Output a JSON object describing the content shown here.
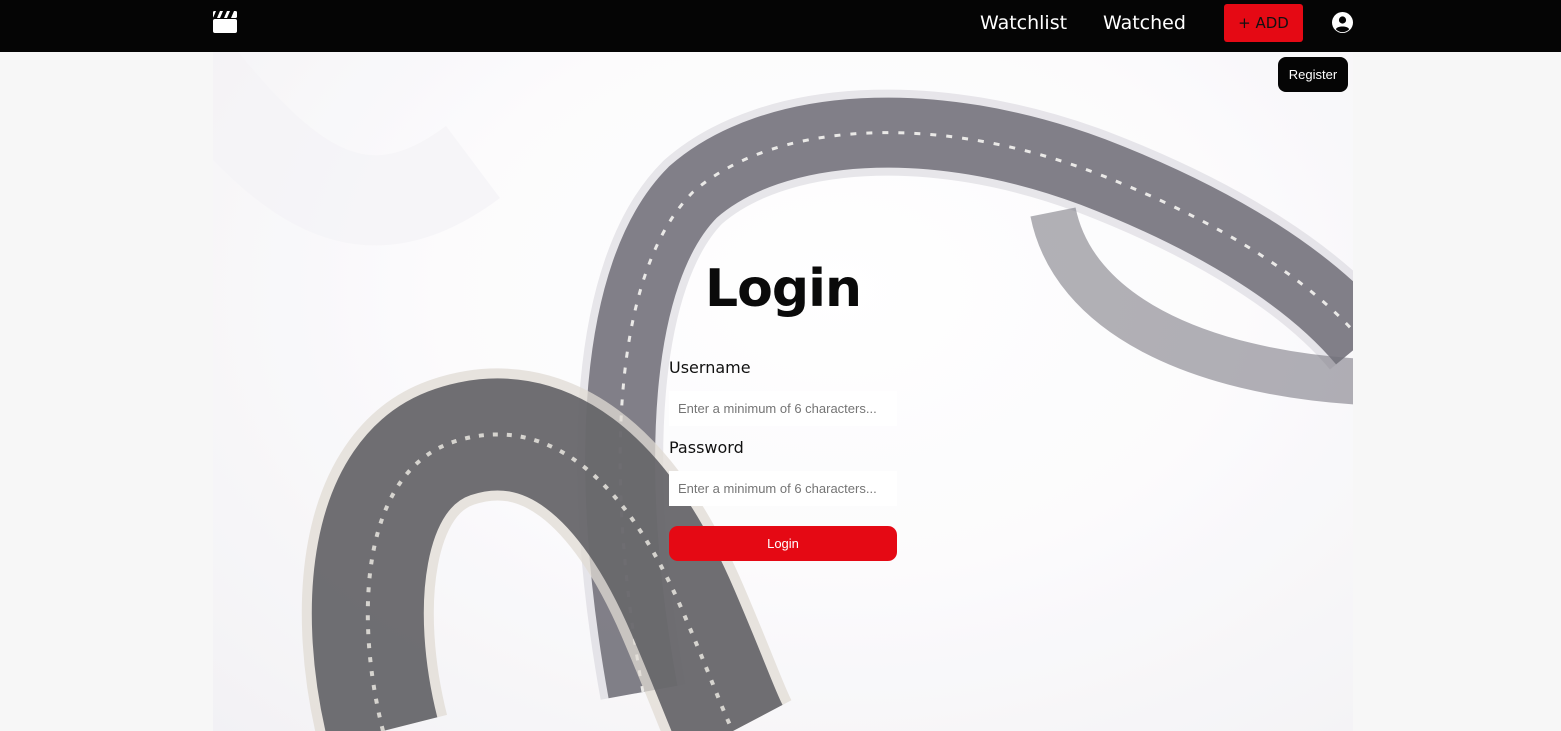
{
  "navbar": {
    "logo_icon": "clapperboard-icon",
    "links": [
      {
        "label": "Watchlist"
      },
      {
        "label": "Watched"
      }
    ],
    "add_label": "+ ADD",
    "account_icon": "user-circle-icon"
  },
  "register_label": "Register",
  "login_form": {
    "title": "Login",
    "username_label": "Username",
    "username_placeholder": "Enter a minimum of 6 characters...",
    "password_label": "Password",
    "password_placeholder": "Enter a minimum of 6 characters...",
    "submit_label": "Login"
  },
  "colors": {
    "navbar": "#050505",
    "accent": "#e50914",
    "page_background": "#f7f7f7"
  }
}
